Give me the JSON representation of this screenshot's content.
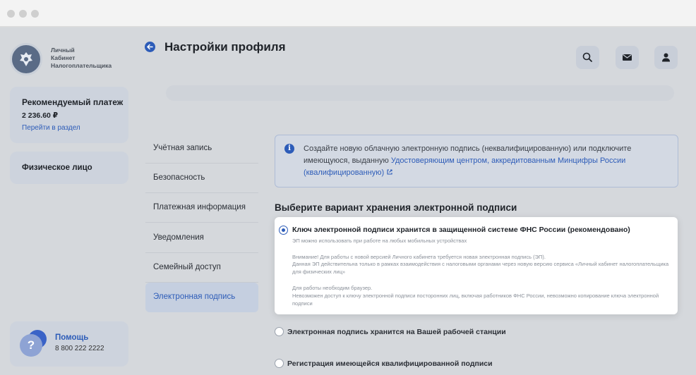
{
  "sidebar": {
    "logo_text": "Личный\nКабинет\nНалогоплательщика",
    "payment": {
      "title": "Рекомендуемый платеж",
      "amount": "2 236.60 ₽",
      "link": "Перейти в раздел"
    },
    "person": {
      "title": "Физическое лицо"
    },
    "help": {
      "title": "Помощь",
      "phone": "8 800 222 2222"
    }
  },
  "header": {
    "title": "Настройки профиля",
    "icons": [
      "search-icon",
      "mail-icon",
      "user-icon"
    ]
  },
  "nav": {
    "items": [
      {
        "label": "Учётная запись",
        "active": false
      },
      {
        "label": "Безопасность",
        "active": false
      },
      {
        "label": "Платежная информация",
        "active": false
      },
      {
        "label": "Уведомления",
        "active": false
      },
      {
        "label": "Семейный доступ",
        "active": false
      },
      {
        "label": "Электронная подпись",
        "active": true
      }
    ]
  },
  "info": {
    "text": "Создайте новую облачную электронную подпись (неквалифицированную) или подключите имеющуюся, выданную ",
    "link": "Удостоверяющим центром, аккредитованным Минцифры России (квалифицированную)"
  },
  "section": {
    "title": "Выберите вариант хранения электронной подписи"
  },
  "options": [
    {
      "title": "Ключ электронной подписи хранится в защищенной системе ФНС России (рекомендовано)",
      "checked": true,
      "line1": "ЭП можно использовать при работе на любых мобильных устройствах",
      "line2": "Внимание! Для работы с новой версией Личного кабинета требуется новая электронная подпись (ЭП).",
      "line3": "Данная ЭП действительна только в рамках взаимодействия с налоговыми органами через новую версию сервиса «Личный кабинет налогоплательщика для физических лиц»",
      "line4": "Для работы необходим браузер.",
      "line5": "Невозможен доступ к ключу электронной подписи посторонних лиц, включая работников ФНС России, невозможно копирование ключа электронной подписи"
    },
    {
      "title": "Электронная подпись хранится на Вашей рабочей станции",
      "checked": false
    },
    {
      "title": "Регистрация имеющейся квалифицированной подписи",
      "checked": false
    }
  ],
  "colors": {
    "accent": "#2d5cb8",
    "background": "#d5d8dc"
  }
}
